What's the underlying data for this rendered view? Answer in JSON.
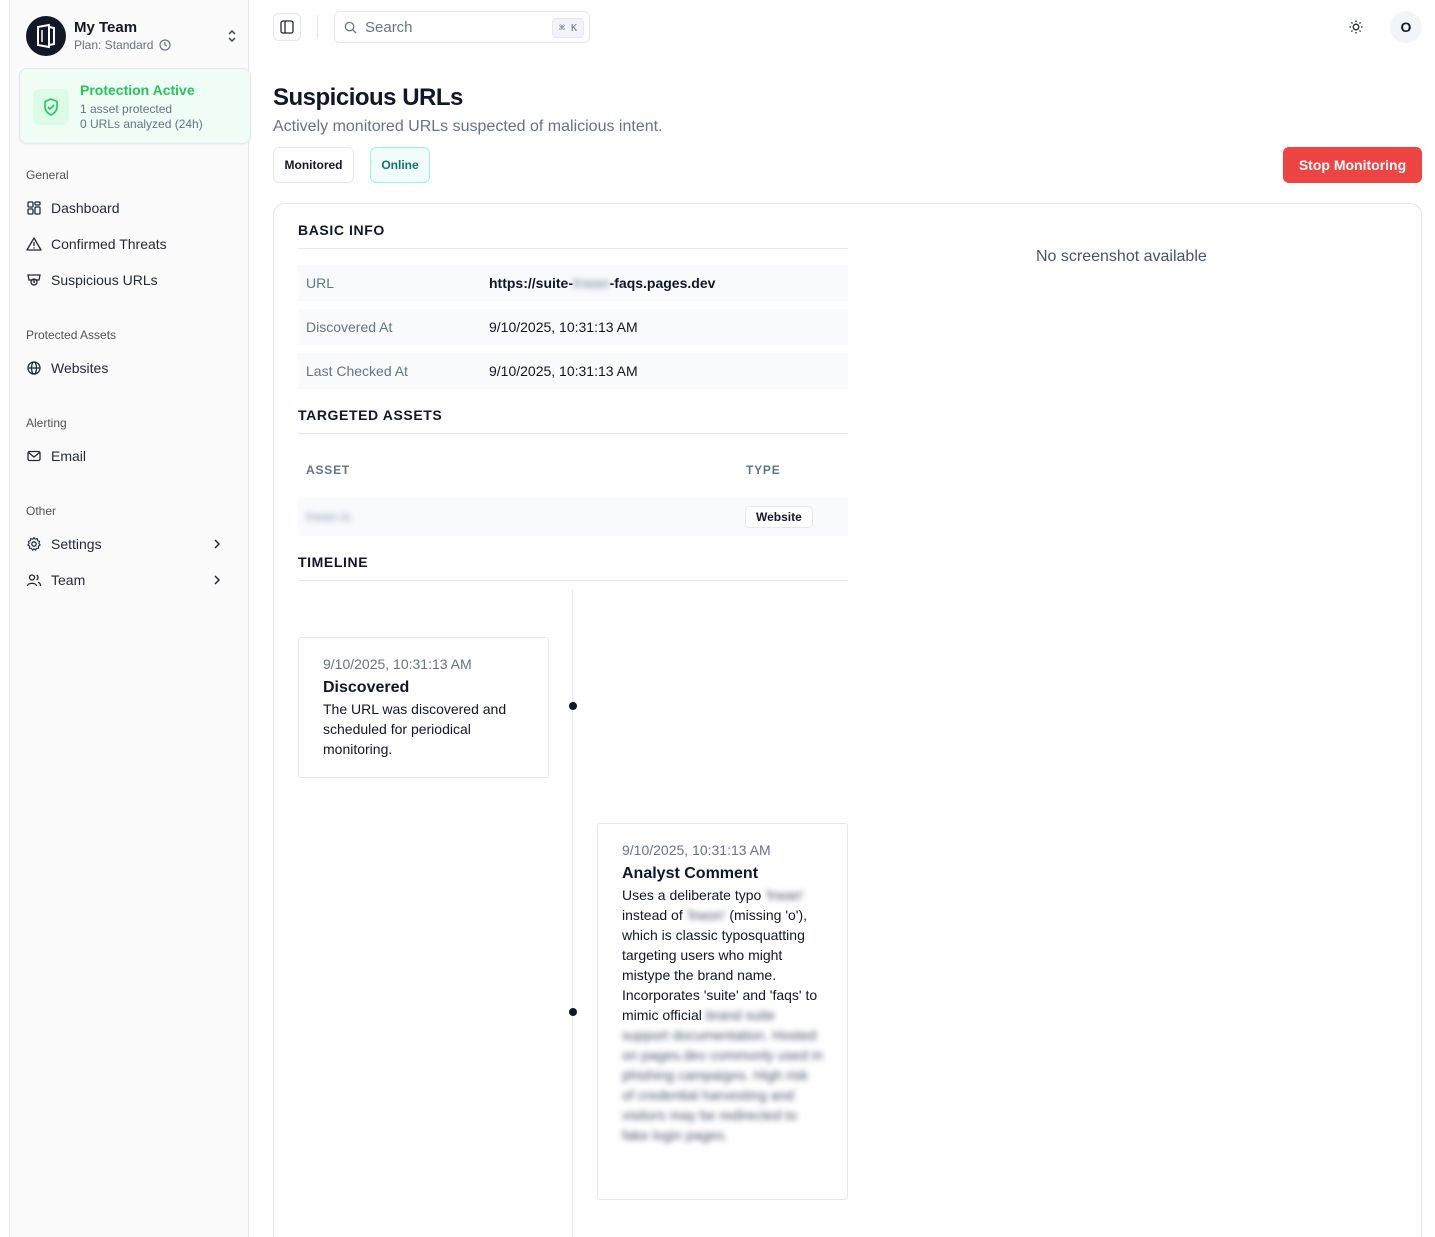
{
  "team": {
    "name": "My Team",
    "plan": "Plan: Standard"
  },
  "protection": {
    "title": "Protection Active",
    "assets_line": "1 asset protected",
    "urls_line": "0 URLs analyzed (24h)"
  },
  "nav": {
    "general_label": "General",
    "dashboard": "Dashboard",
    "confirmed_threats": "Confirmed Threats",
    "suspicious_urls": "Suspicious URLs",
    "protected_label": "Protected Assets",
    "websites": "Websites",
    "alerting_label": "Alerting",
    "email": "Email",
    "other_label": "Other",
    "settings": "Settings",
    "team": "Team"
  },
  "topbar": {
    "search_placeholder": "Search",
    "shortcut": "⌘ K",
    "avatar_initial": "O"
  },
  "header": {
    "title": "Suspicious URLs",
    "subtitle": "Actively monitored URLs suspected of malicious intent.",
    "badge_monitored": "Monitored",
    "badge_online": "Online",
    "stop_button": "Stop Monitoring"
  },
  "basic_info": {
    "title": "BASIC INFO",
    "url_label": "URL",
    "url_prefix": "https://suite-",
    "url_redacted": "lrwan",
    "url_suffix": "-faqs.pages.dev",
    "discovered_label": "Discovered At",
    "discovered_value": "9/10/2025, 10:31:13 AM",
    "checked_label": "Last Checked At",
    "checked_value": "9/10/2025, 10:31:13 AM"
  },
  "targeted_assets": {
    "title": "TARGETED ASSETS",
    "col_asset": "ASSET",
    "col_type": "TYPE",
    "rows": [
      {
        "asset": "lrwan.io",
        "type": "Website"
      }
    ]
  },
  "screenshot": {
    "empty_text": "No screenshot available"
  },
  "timeline": {
    "title": "TIMELINE",
    "events": [
      {
        "time": "9/10/2025, 10:31:13 AM",
        "title": "Discovered",
        "body": "The URL was discovered and scheduled for periodical monitoring."
      },
      {
        "time": "9/10/2025, 10:31:13 AM",
        "title": "Analyst Comment",
        "body_1": "Uses a deliberate typo",
        "redacted_1": "'lrwan'",
        "body_2": "instead of",
        "redacted_2": "'lrwon'",
        "body_3": "(missing 'o'), which is classic typosquatting targeting users who might mistype the brand name. Incorporates 'suite' and 'faqs' to mimic official",
        "redacted_tail": "brand suite support documentation. Hosted on pages.dev commonly used in phishing campaigns. High risk of credential harvesting and visitors may be redirected to fake login pages."
      }
    ]
  }
}
